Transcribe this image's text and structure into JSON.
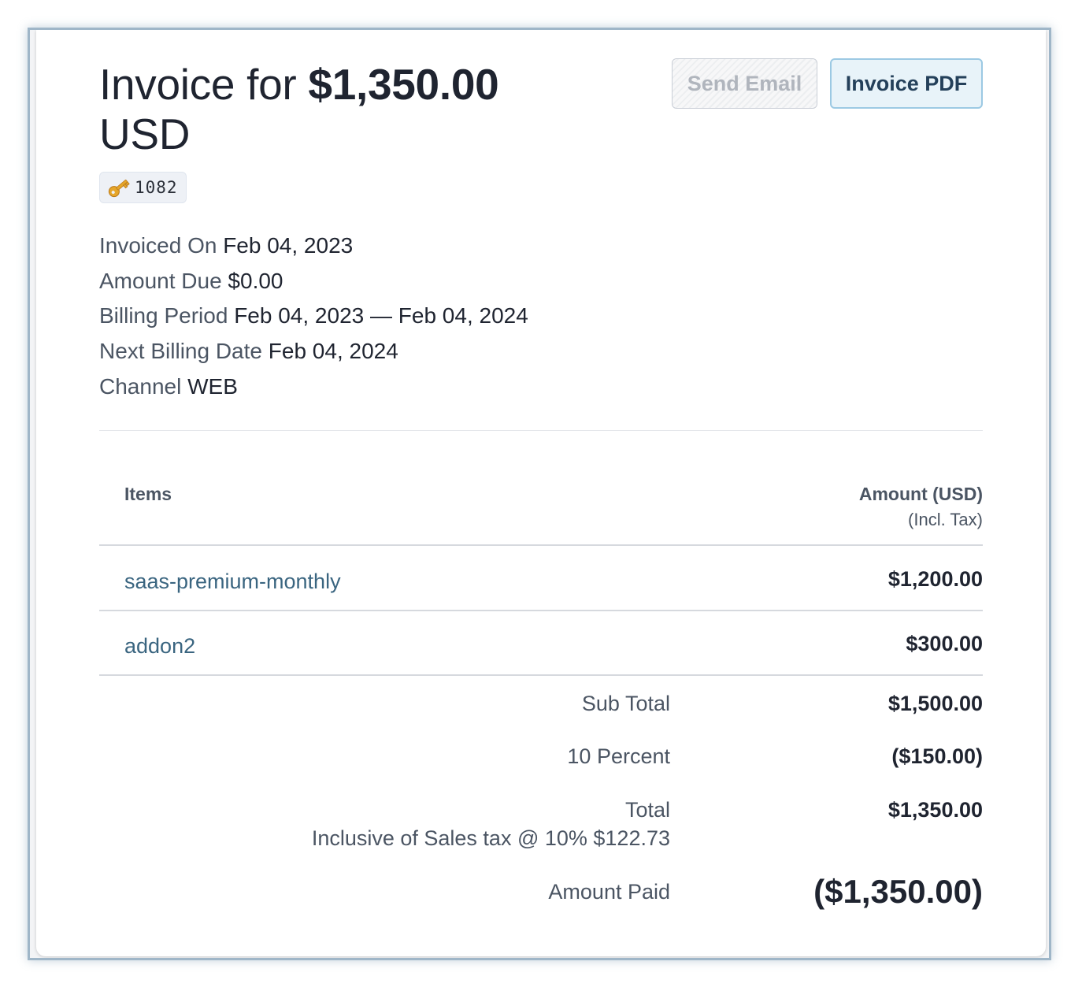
{
  "invoice": {
    "title_prefix": "Invoice for",
    "title_amount": "$1,350.00",
    "title_currency": "USD",
    "id_badge": "1082",
    "id_icon": "key-icon"
  },
  "actions": {
    "send_email_label": "Send Email",
    "send_email_disabled": true,
    "invoice_pdf_label": "Invoice PDF"
  },
  "meta": [
    {
      "label": "Invoiced On",
      "value": "Feb 04, 2023"
    },
    {
      "label": "Amount Due",
      "value": "$0.00"
    },
    {
      "label": "Billing Period",
      "value": "Feb 04, 2023 — Feb 04, 2024"
    },
    {
      "label": "Next Billing Date",
      "value": "Feb 04, 2024"
    },
    {
      "label": "Channel",
      "value": "WEB"
    }
  ],
  "table": {
    "col_items": "Items",
    "col_amount": "Amount (USD)",
    "col_amount_note": "(Incl. Tax)",
    "rows": [
      {
        "name": "saas-premium-monthly",
        "amount": "$1,200.00"
      },
      {
        "name": "addon2",
        "amount": "$300.00"
      }
    ]
  },
  "summary": {
    "subtotal_label": "Sub Total",
    "subtotal_value": "$1,500.00",
    "discount_label": "10 Percent",
    "discount_value": "($150.00)",
    "total_label": "Total",
    "total_note": "Inclusive of Sales tax @ 10% $122.73",
    "total_value": "$1,350.00",
    "paid_label": "Amount Paid",
    "paid_value": "($1,350.00)"
  },
  "colors": {
    "link": "#3a6580",
    "pdf_button_bg": "#e8f3f9",
    "pdf_button_border": "#9cc9e3",
    "frame_border": "#9fb6c8"
  }
}
